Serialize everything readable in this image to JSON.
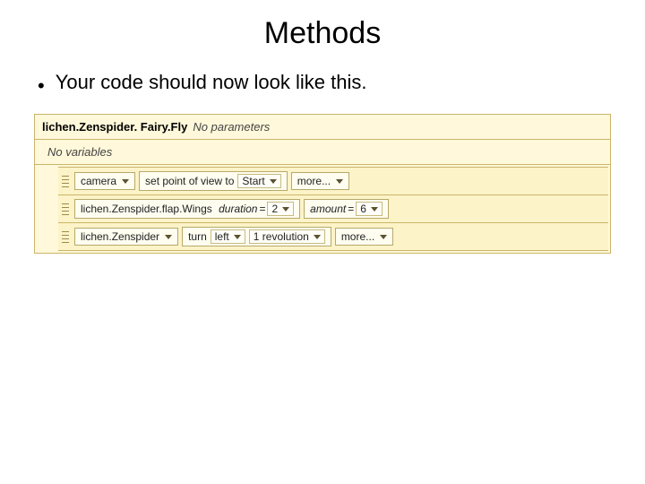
{
  "title": "Methods",
  "bullet_text": "Your code should now look like this.",
  "header": {
    "method_name": "lichen.Zenspider. Fairy.Fly",
    "param_note": "No parameters"
  },
  "vars_note": "No variables",
  "row1": {
    "subject": "camera",
    "verb": "set point of view to",
    "target": "Start",
    "more": "more..."
  },
  "row2": {
    "subject": "lichen.Zenspider.flap.Wings",
    "p1_label": "duration",
    "p1_value": "2",
    "p2_label": "amount",
    "p2_value": "6"
  },
  "row3": {
    "subject": "lichen.Zenspider",
    "verb": "turn",
    "dir": "left",
    "amount": "1 revolution",
    "more": "more..."
  }
}
